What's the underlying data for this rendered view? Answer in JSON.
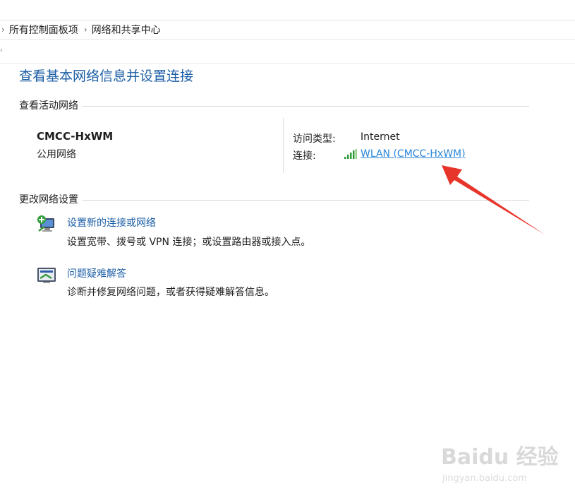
{
  "breadcrumb": {
    "items": [
      "所有控制面板项",
      "网络和共享中心"
    ]
  },
  "page": {
    "title": "查看基本网络信息并设置连接"
  },
  "active_networks": {
    "heading": "查看活动网络",
    "network_name": "CMCC-HxWM",
    "network_type": "公用网络",
    "access_type_label": "访问类型:",
    "access_type_value": "Internet",
    "connection_label": "连接:",
    "connection_value": "WLAN (CMCC-HxWM)"
  },
  "change_settings": {
    "heading": "更改网络设置",
    "tasks": [
      {
        "title": "设置新的连接或网络",
        "description": "设置宽带、拨号或 VPN 连接；或设置路由器或接入点。"
      },
      {
        "title": "问题疑难解答",
        "description": "诊断并修复网络问题，或者获得疑难解答信息。"
      }
    ]
  },
  "watermark": {
    "logo_text": "Baidu 经验",
    "url": "jingyan.baidu.com"
  },
  "colors": {
    "title_blue": "#1c5ea6",
    "link_blue": "#2a86d8",
    "annotation_red": "#e8352c"
  }
}
